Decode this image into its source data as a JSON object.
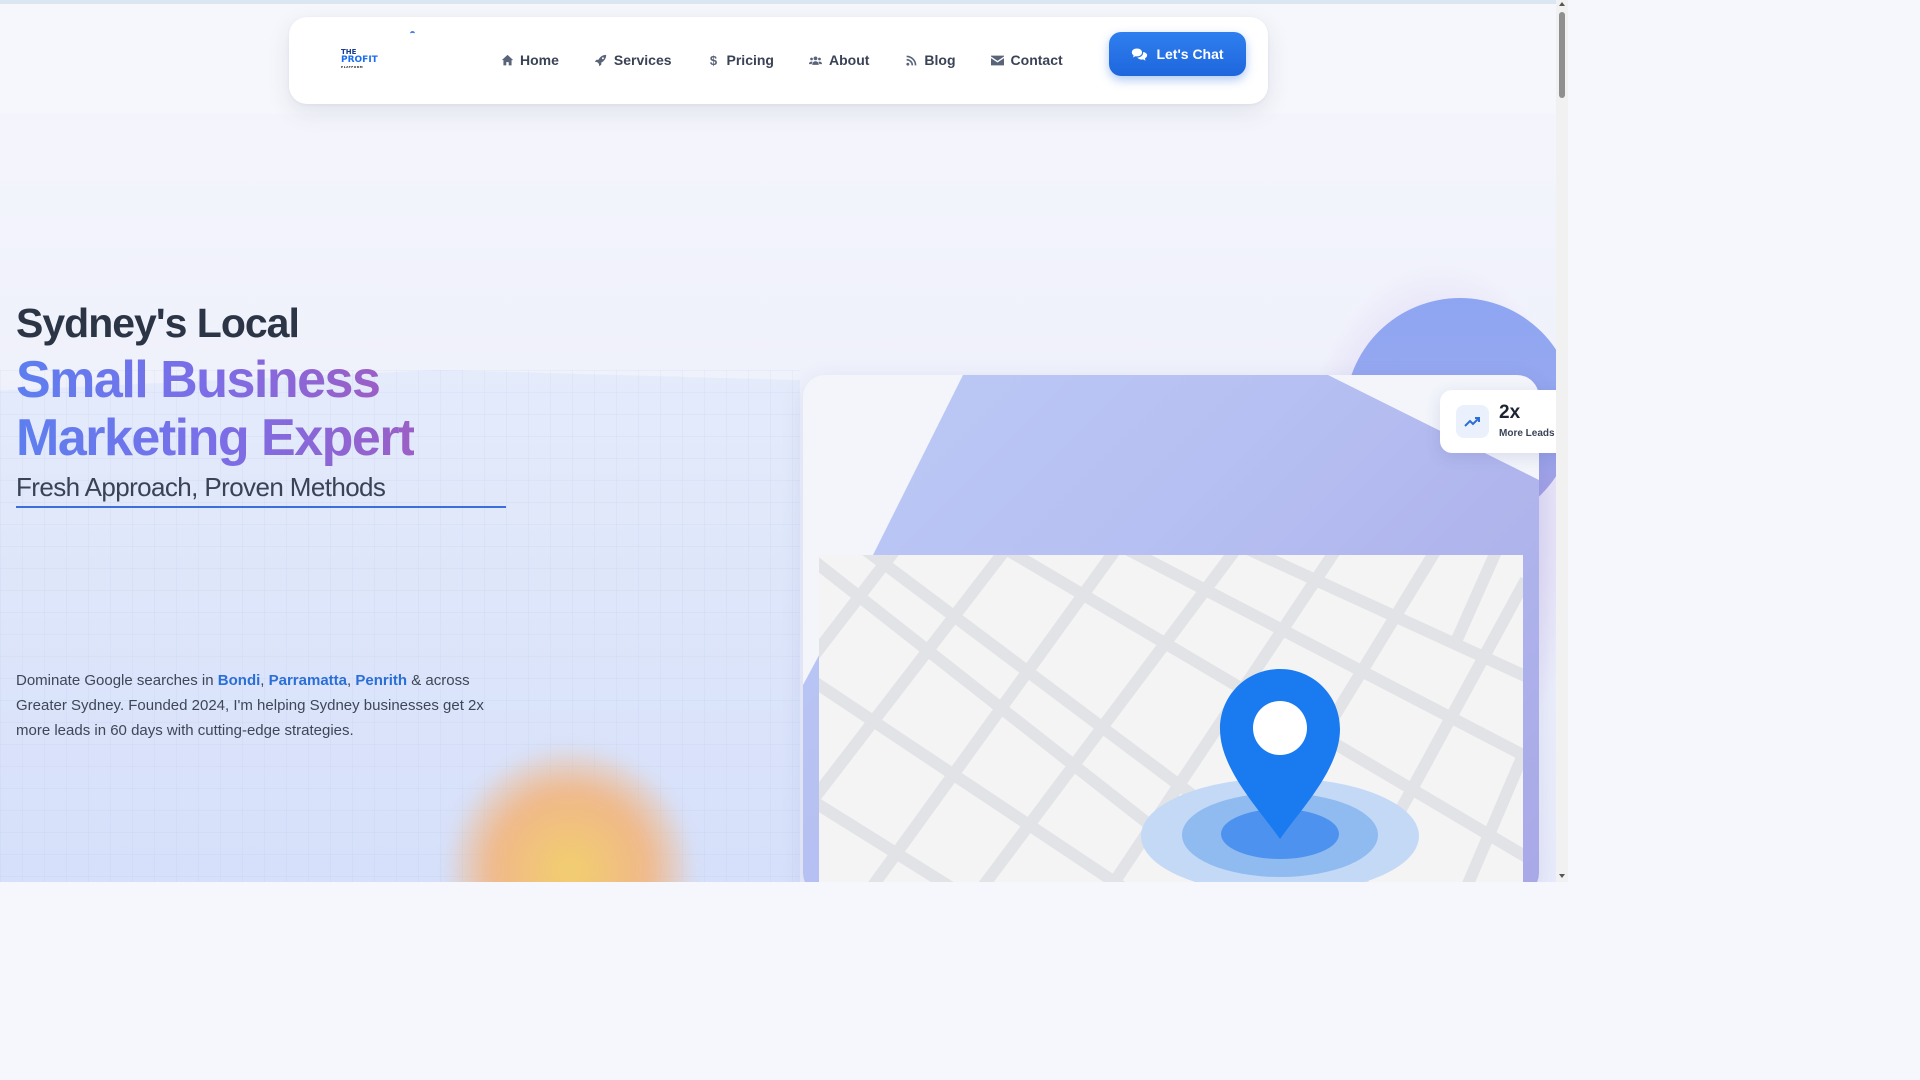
{
  "logo": {
    "line1": "THE",
    "line2": "PROFIT",
    "line3": "PLATFORM"
  },
  "nav": {
    "items": [
      {
        "label": "Home",
        "icon": "home-icon"
      },
      {
        "label": "Services",
        "icon": "rocket-icon"
      },
      {
        "label": "Pricing",
        "icon": "dollar-icon"
      },
      {
        "label": "About",
        "icon": "users-icon"
      },
      {
        "label": "Blog",
        "icon": "blog-icon"
      },
      {
        "label": "Contact",
        "icon": "envelope-icon"
      }
    ],
    "cta_label": "Let's Chat",
    "cta_icon": "chat-icon"
  },
  "hero": {
    "line1": "Sydney's Local",
    "line2": "Small Business",
    "line3": "Marketing Expert",
    "tagline": "Fresh Approach, Proven Methods",
    "desc_prefix": "Dominate Google searches in ",
    "locations": [
      "Bondi",
      "Parramatta",
      "Penrith"
    ],
    "desc_sep": ", ",
    "desc_suffix": " & across Greater Sydney. Founded 2024, I'm helping Sydney businesses get 2x more leads in 60 days with cutting-edge strategies."
  },
  "stat": {
    "value": "2x",
    "label": "More Leads",
    "icon": "trending-up-icon"
  },
  "colors": {
    "accent": "#1e66dc",
    "gradient_start": "#5d7ff0",
    "gradient_end": "#9b5fc6",
    "pin": "#1a7af0"
  }
}
